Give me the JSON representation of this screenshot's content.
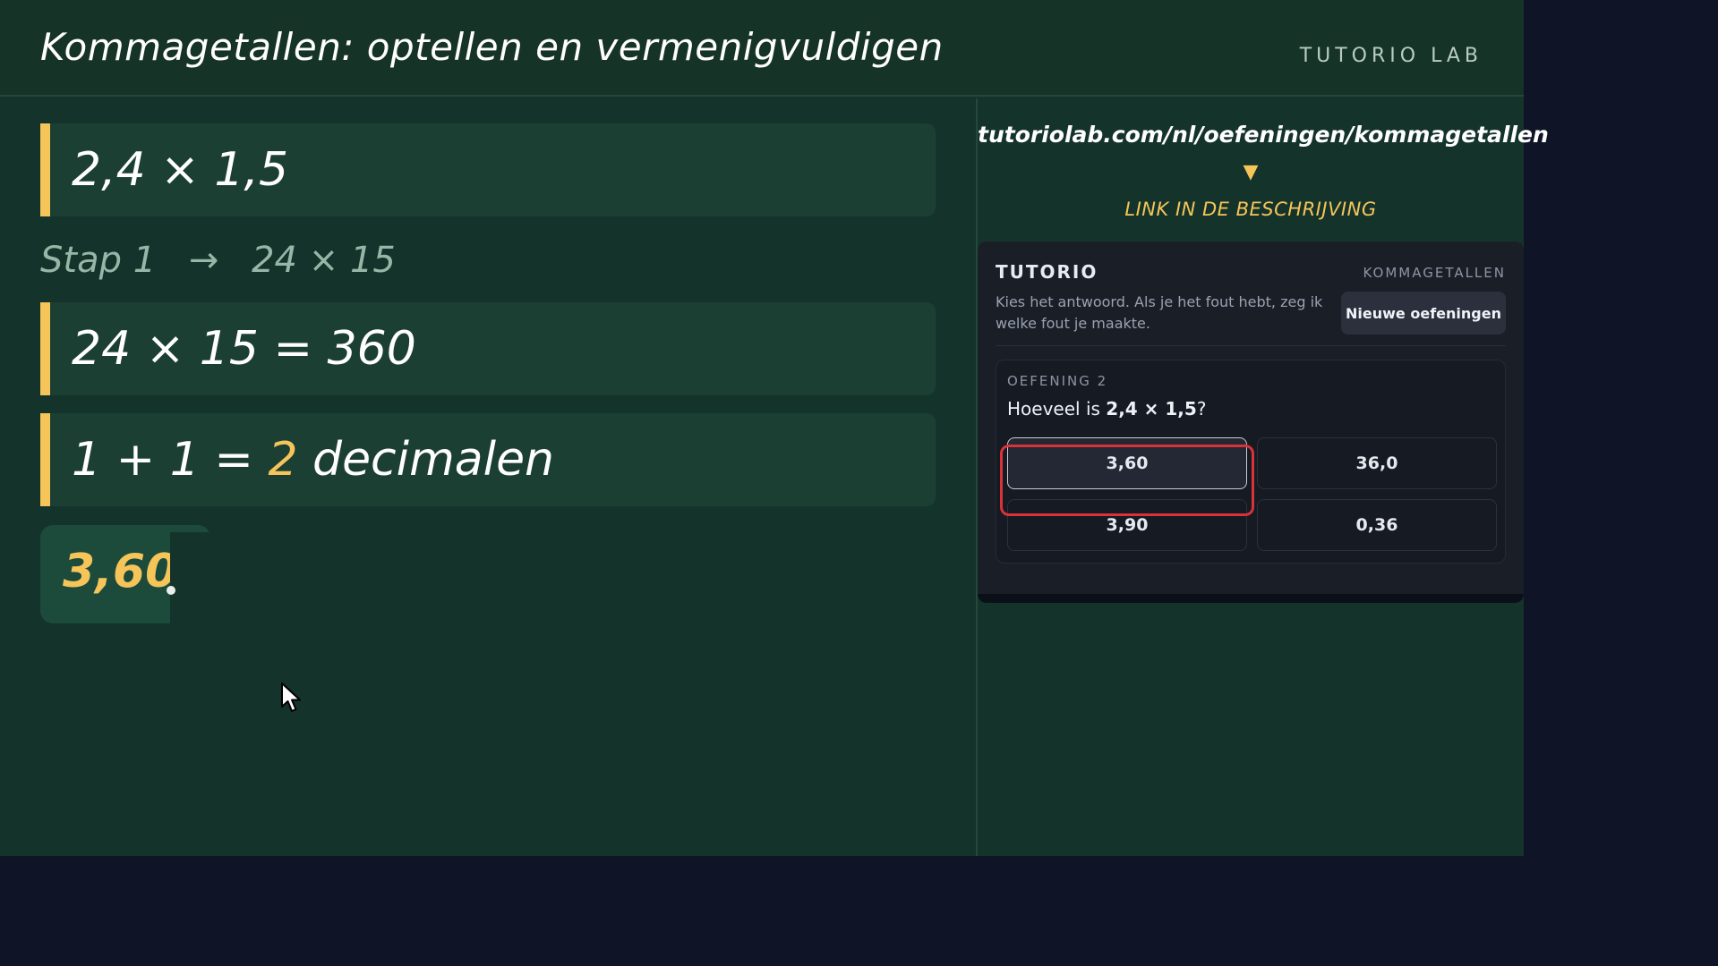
{
  "header": {
    "title": "Kommagetallen: optellen en vermenigvuldigen",
    "brand": "TUTORIO LAB"
  },
  "board": {
    "problem": "2,4 × 1,5",
    "step_label": "Stap 1",
    "step_arrow": "→",
    "step_value": "24 × 15",
    "product_line": "24 × 15 = 360",
    "decimals_prefix": "1 + 1 = ",
    "decimals_count": "2",
    "decimals_suffix": " decimalen",
    "partial_answer": "3,60"
  },
  "promo": {
    "url": "tutoriolab.com/nl/oefeningen/kommagetallen",
    "arrow": "▼",
    "link_label": "LINK IN DE BESCHRIJVING"
  },
  "widget": {
    "brand": "TUTORIO",
    "topic": "KOMMAGETALLEN",
    "description": "Kies het antwoord. Als je het fout hebt, zeg ik welke fout je maakte.",
    "new_button": "Nieuwe oefeningen",
    "exercise": {
      "label": "OEFENING 2",
      "question_prefix": "Hoeveel is ",
      "question_expr": "2,4 × 1,5",
      "question_suffix": "?",
      "options": [
        "3,60",
        "36,0",
        "3,90",
        "0,36"
      ],
      "selected": "3,60"
    }
  },
  "colors": {
    "board": "#14332a",
    "accent": "#f5c55a",
    "highlight": "#d8323a"
  }
}
